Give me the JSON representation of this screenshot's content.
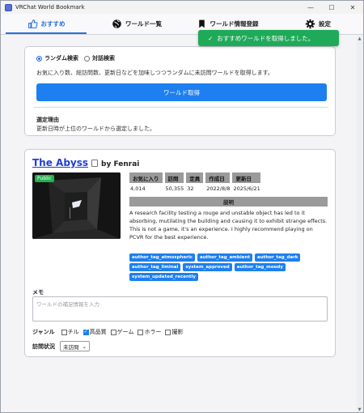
{
  "window": {
    "title": "VRChat World Bookmark"
  },
  "tabs": [
    {
      "label": "おすすめ",
      "icon": "thumbs-up-icon",
      "active": true
    },
    {
      "label": "ワールド一覧",
      "icon": "globe-icon",
      "active": false
    },
    {
      "label": "ワールド情報登録",
      "icon": "bookmark-icon",
      "active": false
    },
    {
      "label": "設定",
      "icon": "gear-icon",
      "active": false
    }
  ],
  "toast": {
    "text": "おすすめワールドを取得しました。",
    "color": "#1faa59"
  },
  "recommend": {
    "mode_options": [
      "ランダム検索",
      "対話検索"
    ],
    "selected_mode": "ランダム検索",
    "description": "お気に入り数、総訪問数、更新日などを加味しつつランダムに未訪問ワールドを取得します。",
    "fetch_button": "ワールド取得",
    "reason_title": "選定理由",
    "reason_text": "更新日時が上位のワールドから選定しました。"
  },
  "world": {
    "name": "The Abyss",
    "author": "by Fenrai",
    "visibility": "Public",
    "stats": [
      {
        "label": "お気に入り",
        "value": "4,014"
      },
      {
        "label": "訪問",
        "value": "50,355"
      },
      {
        "label": "定員",
        "value": "32"
      },
      {
        "label": "作成日",
        "value": "2022/8/8"
      },
      {
        "label": "更新日",
        "value": "2025/6/21"
      }
    ],
    "description_header": "説明",
    "description": "A research facility testing a rouge and unstable object has led to it absorbing, mutilating the building and causing it to exhibit strange effects. This is not a game, it's an experience. I highly recommend playing on PCVR for the best experience.",
    "tags": [
      "author_tag_atmospheric",
      "author_tag_ambient",
      "author_tag_dark",
      "author_tag_liminal",
      "system_approved",
      "author_tag_moody",
      "system_updated_recently"
    ]
  },
  "memo": {
    "label": "メモ",
    "placeholder": "ワールドの補足情報を入力"
  },
  "genre": {
    "label": "ジャンル",
    "options": [
      {
        "label": "チル",
        "checked": false
      },
      {
        "label": "高品質",
        "checked": true
      },
      {
        "label": "ゲーム",
        "checked": false
      },
      {
        "label": "ホラー",
        "checked": false
      },
      {
        "label": "撮影",
        "checked": false
      }
    ]
  },
  "visit": {
    "label": "訪問状況",
    "value": "未訪問"
  }
}
